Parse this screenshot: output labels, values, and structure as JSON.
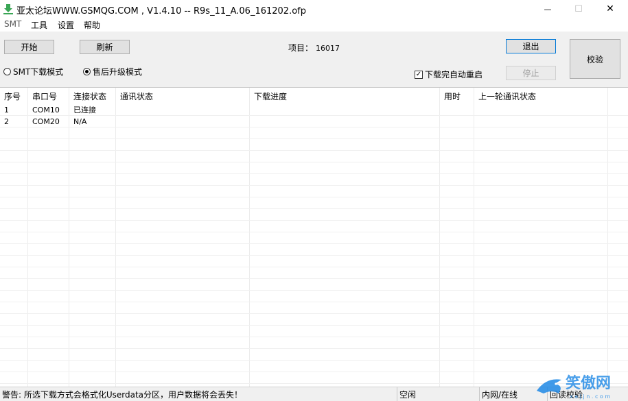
{
  "window": {
    "title": "亚太论坛WWW.GSMQG.COM    , V1.4.10 -- R9s_11_A.06_161202.ofp",
    "min_glyph": "—",
    "max_glyph": "☐",
    "close_glyph": "✕"
  },
  "menu": [
    "SMT",
    "工具",
    "设置",
    "帮助"
  ],
  "toolbar": {
    "start_label": "开始",
    "refresh_label": "刷新",
    "project_label": "项目：",
    "project_value": "16017",
    "exit_label": "退出",
    "stop_label": "停止",
    "verify_label": "校验",
    "mode_smt_label": "SMT下载模式",
    "mode_after_label": "售后升级模式",
    "selected_mode": "售后升级模式",
    "reboot_label": "下载完自动重启",
    "reboot_checked": true
  },
  "table": {
    "columns": [
      "序号",
      "串口号",
      "连接状态",
      "通讯状态",
      "下载进度",
      "用时",
      "上一轮通讯状态"
    ],
    "rows": [
      [
        "1",
        "COM10",
        "已连接",
        "",
        "",
        "",
        ""
      ],
      [
        "2",
        "COM20",
        "N/A",
        "",
        "",
        "",
        ""
      ]
    ]
  },
  "status": {
    "warning": "警告: 所选下载方式会格式化Userdata分区，用户数据将会丢失！",
    "state": "空闲",
    "network": "内网/在线",
    "readback": "回读校验"
  },
  "colors": {
    "panel_bg": "#f0f0f0",
    "accent_border": "#0078d7",
    "icon_green": "#3aa655"
  }
}
